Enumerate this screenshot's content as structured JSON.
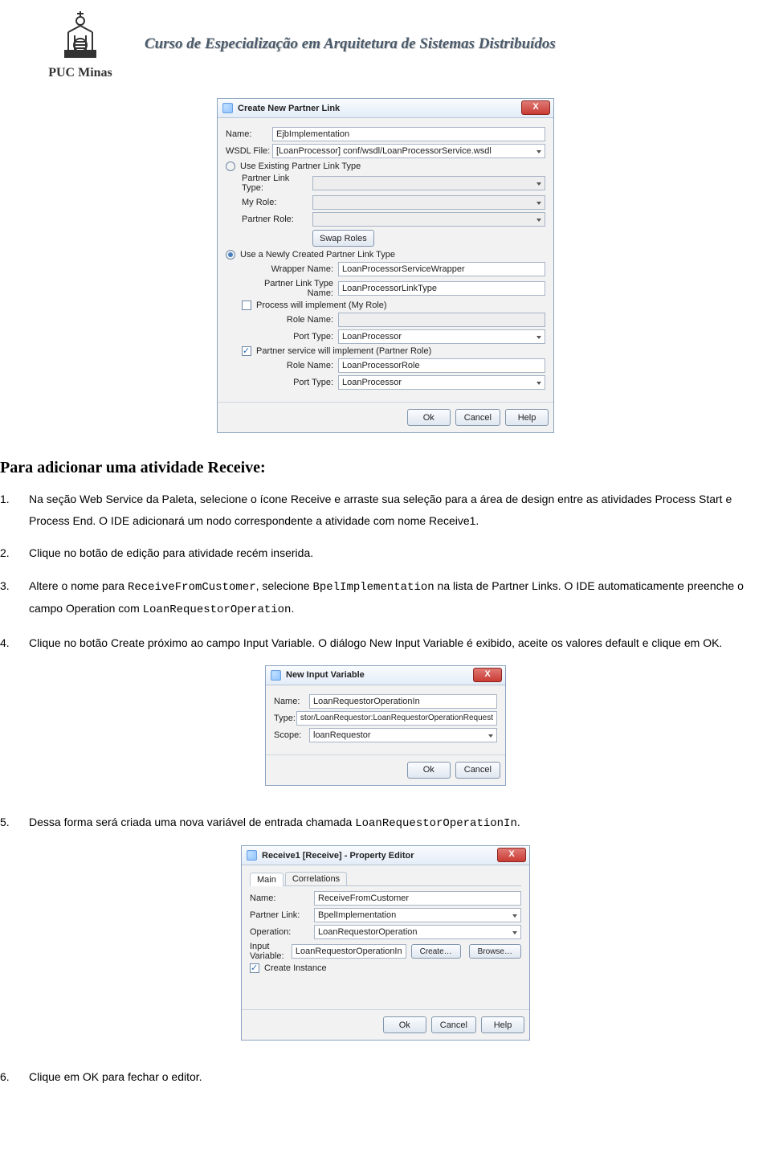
{
  "header": {
    "logo_text": "PUC Minas",
    "course_title": "Curso de Especialização em Arquitetura de Sistemas Distribuídos"
  },
  "dialog1": {
    "title": "Create New Partner Link",
    "close": "X",
    "name_lbl": "Name:",
    "name_val": "EjbImplementation",
    "wsdl_lbl": "WSDL File:",
    "wsdl_val": "[LoanProcessor] conf/wsdl/LoanProcessorService.wsdl",
    "radio_existing": "Use Existing Partner Link Type",
    "plt_lbl": "Partner Link Type:",
    "myrole_lbl": "My Role:",
    "prole_lbl": "Partner Role:",
    "swap": "Swap Roles",
    "radio_new": "Use a Newly Created Partner Link Type",
    "wrap_name_lbl": "Wrapper Name:",
    "wrap_name_val": "LoanProcessorServiceWrapper",
    "plt_name_lbl": "Partner Link Type Name:",
    "plt_name_val": "LoanProcessorLinkType",
    "chk_process": "Process will implement (My Role)",
    "rolename_lbl": "Role Name:",
    "porttype_lbl": "Port Type:",
    "porttype_val": "LoanProcessor",
    "chk_partner": "Partner service will implement (Partner Role)",
    "rolename2_val": "LoanProcessorRole",
    "porttype2_val": "LoanProcessor",
    "ok": "Ok",
    "cancel": "Cancel",
    "help": "Help"
  },
  "section_title": "Para adicionar uma atividade Receive:",
  "steps": {
    "s1": "Na seção Web Service da Paleta, selecione o ícone Receive e arraste sua seleção para a área de design entre as atividades Process Start e Process End. O IDE adicionará um nodo correspondente a atividade com nome Receive1.",
    "s2": "Clique no botão de edição para atividade recém inserida.",
    "s3_a": "Altere o nome para ",
    "s3_code1": "ReceiveFromCustomer",
    "s3_b": ", selecione ",
    "s3_code2": "BpelImplementation",
    "s3_c": " na lista de Partner Links. O IDE automaticamente preenche o campo Operation com ",
    "s3_code3": "LoanRequestorOperation",
    "s3_d": ".",
    "s4": "Clique no botão Create próximo ao campo Input Variable. O diálogo New Input Variable é exibido, aceite os valores default e clique em OK.",
    "s5_a": "Dessa forma será criada uma nova variável de entrada chamada ",
    "s5_code": "LoanRequestorOperationIn",
    "s5_b": ".",
    "s6": "Clique em OK para fechar o editor."
  },
  "dialog2": {
    "title": "New Input Variable",
    "close": "X",
    "name_lbl": "Name:",
    "name_val": "LoanRequestorOperationIn",
    "type_lbl": "Type:",
    "type_val": "stor/LoanRequestor:LoanRequestorOperationRequest",
    "scope_lbl": "Scope:",
    "scope_val": "loanRequestor",
    "ok": "Ok",
    "cancel": "Cancel"
  },
  "dialog3": {
    "title": "Receive1 [Receive] - Property Editor",
    "close": "X",
    "tab_main": "Main",
    "tab_corr": "Correlations",
    "name_lbl": "Name:",
    "name_val": "ReceiveFromCustomer",
    "pl_lbl": "Partner Link:",
    "pl_val": "BpelImplementation",
    "op_lbl": "Operation:",
    "op_val": "LoanRequestorOperation",
    "iv_lbl": "Input Variable:",
    "iv_val": "LoanRequestorOperationIn",
    "btn_create": "Create…",
    "btn_browse": "Browse…",
    "chk_instance": "Create Instance",
    "ok": "Ok",
    "cancel": "Cancel",
    "help": "Help"
  }
}
